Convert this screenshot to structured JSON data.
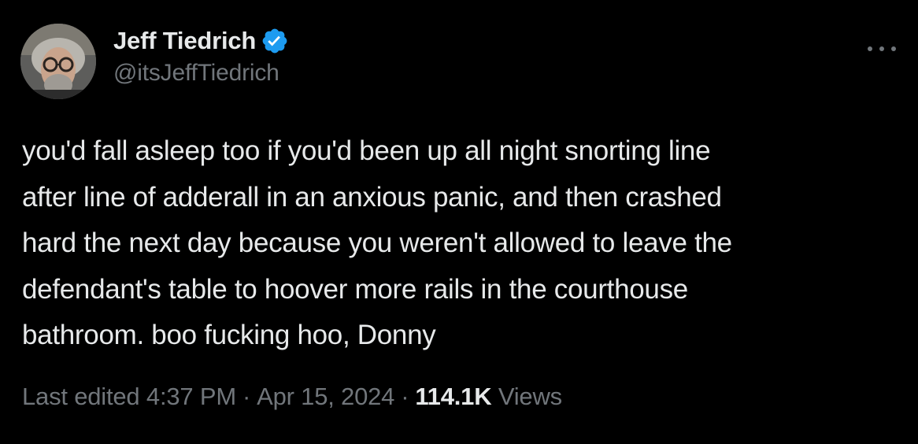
{
  "author": {
    "display_name": "Jeff Tiedrich",
    "handle": "@itsJeffTiedrich",
    "verified": true,
    "verified_color": "#1d9bf0",
    "avatar_icon": "profile-photo"
  },
  "more_menu": {
    "icon": "more-horizontal-icon"
  },
  "tweet": {
    "text_lines": [
      "you'd fall asleep too if you'd been up all night snorting line",
      "after line of adderall in an anxious panic, and then crashed",
      "hard the next day because you weren't allowed to leave the",
      "defendant's table to hoover more rails in the courthouse",
      "bathroom. boo fucking hoo, Donny"
    ]
  },
  "meta": {
    "edited_label": "Last edited",
    "time": "4:37 PM",
    "separator": "·",
    "date": "Apr 15, 2024",
    "views_count": "114.1K",
    "views_label": "Views"
  },
  "colors": {
    "background": "#000000",
    "primary_text": "#e7e9ea",
    "secondary_text": "#71767b",
    "accent": "#1d9bf0"
  }
}
